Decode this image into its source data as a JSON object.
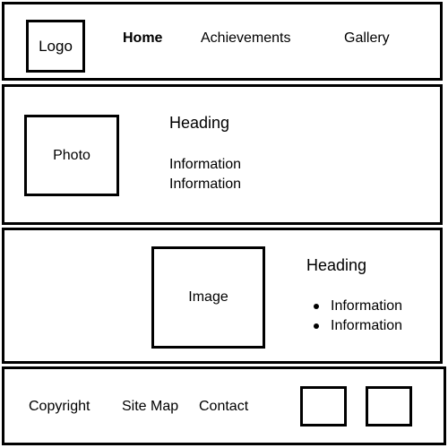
{
  "header": {
    "logo_label": "Logo",
    "nav": {
      "home": "Home",
      "achievements": "Achievements",
      "gallery": "Gallery"
    }
  },
  "about": {
    "photo_label": "Photo",
    "heading": "Heading",
    "info": [
      "Information",
      "Information"
    ]
  },
  "feature": {
    "image_label": "Image",
    "heading": "Heading",
    "bullets": [
      "Information",
      "Information"
    ]
  },
  "footer": {
    "links": {
      "copyright": "Copyright",
      "site_map": "Site Map",
      "contact": "Contact"
    }
  },
  "colors": {
    "stroke": "#000000",
    "background": "#ffffff"
  }
}
